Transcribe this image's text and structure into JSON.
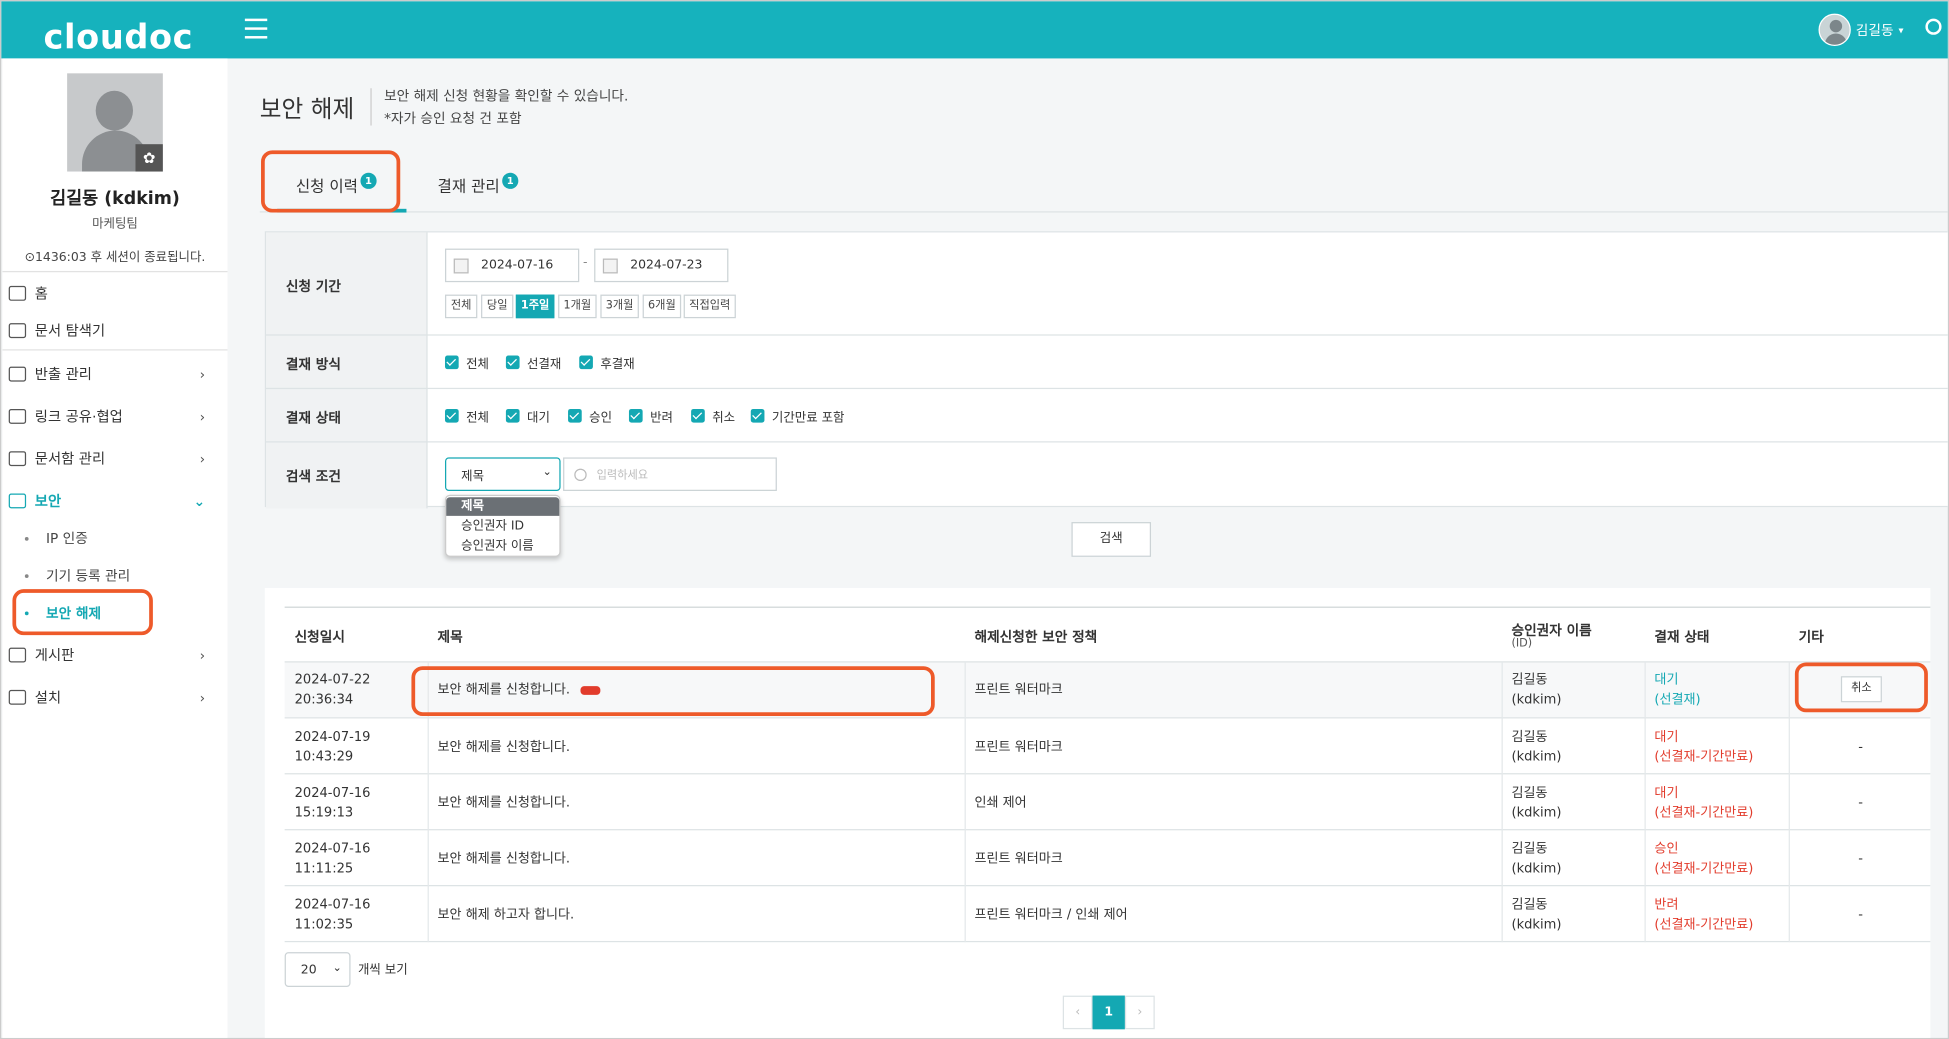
{
  "header": {
    "logo_text": "cloudoc",
    "user_name": "김길동",
    "caret": "▾"
  },
  "colors": {
    "primary": "#16b2bd",
    "highlight": "#ee5a2a",
    "danger": "#e23c2c"
  },
  "profile": {
    "name": "김길동 (kdkim)",
    "department": "마케팅팀",
    "session_notice": "⊙1436:03 후 세션이 종료됩니다."
  },
  "sidebar": {
    "items": [
      {
        "label": "홈",
        "icon": "home-icon"
      },
      {
        "label": "문서 탐색기",
        "icon": "folder-icon"
      },
      {
        "label": "반출 관리",
        "icon": "export-icon",
        "arrow": "›"
      },
      {
        "label": "링크 공유·협업",
        "icon": "link-icon",
        "arrow": "›"
      },
      {
        "label": "문서함 관리",
        "icon": "docbox-icon",
        "arrow": "›"
      },
      {
        "label": "보안",
        "icon": "lock-icon",
        "arrow": "⌄"
      },
      {
        "label": "게시판",
        "icon": "board-icon",
        "arrow": "›"
      },
      {
        "label": "설치",
        "icon": "download-icon",
        "arrow": "›"
      }
    ],
    "sub_items": [
      {
        "label": "IP 인증"
      },
      {
        "label": "기기 등록 관리"
      },
      {
        "label": "보안 해제"
      }
    ]
  },
  "page": {
    "title": "보안 해제",
    "desc1": "보안 해제 신청 현황을 확인할 수 있습니다.",
    "desc2": "*자가 승인 요청 건 포함",
    "tabs": [
      {
        "label": "신청 이력",
        "badge": "1"
      },
      {
        "label": "결재 관리",
        "badge": "1"
      }
    ]
  },
  "filter": {
    "period_label": "신청 기간",
    "date_from": "2024-07-16",
    "date_to": "2024-07-23",
    "date_sep": "-",
    "ranges": [
      "전체",
      "당일",
      "1주일",
      "1개월",
      "3개월",
      "6개월",
      "직접입력"
    ],
    "selected_range": "1주일",
    "method_label": "결재 방식",
    "methods": [
      "전체",
      "선결재",
      "후결재"
    ],
    "status_label": "결재 상태",
    "statuses": [
      "전체",
      "대기",
      "승인",
      "반려",
      "취소",
      "기간만료 포함"
    ],
    "cond_label": "검색 조건",
    "select_value": "제목",
    "select_options": [
      "제목",
      "승인권자 ID",
      "승인권자 이름"
    ],
    "search_placeholder": "입력하세요",
    "search_button": "검색"
  },
  "table": {
    "headers": [
      "신청일시",
      "제목",
      "해제신청한 보안 정책",
      "승인권자 이름",
      "(ID)",
      "결재 상태",
      "기타"
    ],
    "rows": [
      {
        "date": "2024-07-22",
        "time": "20:36:34",
        "title": "보안 해제를 신청합니다.",
        "policy": "프린트 워터마크",
        "approver": "김길동",
        "approver_id": "(kdkim)",
        "status": "대기",
        "status_detail": "(선결재)",
        "etc": "취소"
      },
      {
        "date": "2024-07-19",
        "time": "10:43:29",
        "title": "보안 해제를 신청합니다.",
        "policy": "프린트 워터마크",
        "approver": "김길동",
        "approver_id": "(kdkim)",
        "status": "대기",
        "status_detail": "(선결재-기간만료)",
        "etc": "-"
      },
      {
        "date": "2024-07-16",
        "time": "15:19:13",
        "title": "보안 해제를 신청합니다.",
        "policy": "인쇄 제어",
        "approver": "김길동",
        "approver_id": "(kdkim)",
        "status": "대기",
        "status_detail": "(선결재-기간만료)",
        "etc": "-"
      },
      {
        "date": "2024-07-16",
        "time": "11:11:25",
        "title": "보안 해제를 신청합니다.",
        "policy": "프린트 워터마크",
        "approver": "김길동",
        "approver_id": "(kdkim)",
        "status": "승인",
        "status_detail": "(선결재-기간만료)",
        "etc": "-"
      },
      {
        "date": "2024-07-16",
        "time": "11:02:35",
        "title": "보안 해제 하고자 합니다.",
        "policy": "프린트 워터마크 / 인쇄 제어",
        "approver": "김길동",
        "approver_id": "(kdkim)",
        "status": "반려",
        "status_detail": "(선결재-기간만료)",
        "etc": "-"
      }
    ],
    "per_page": "20",
    "per_page_label": "개씩 보기"
  },
  "pagination": {
    "prev": "‹",
    "current": "1",
    "next": "›"
  }
}
